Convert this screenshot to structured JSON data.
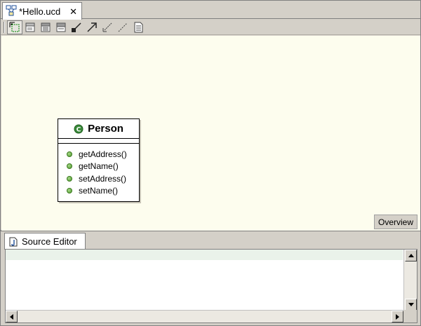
{
  "editor": {
    "tab_title": "*Hello.ucd",
    "tab_close": "✕"
  },
  "toolbar": {
    "buttons": [
      {
        "icon": "select-tool-icon",
        "active": true
      },
      {
        "icon": "class-tool-icon"
      },
      {
        "icon": "interface-tool-icon"
      },
      {
        "icon": "enum-tool-icon"
      },
      {
        "icon": "dependency-tool-icon"
      },
      {
        "icon": "association-tool-icon"
      },
      {
        "icon": "inheritance-tool-icon"
      },
      {
        "icon": "realization-tool-icon"
      },
      {
        "icon": "note-tool-icon"
      }
    ]
  },
  "diagram": {
    "class": {
      "stereotype_glyph": "C",
      "name": "Person",
      "methods": [
        "getAddress()",
        "getName()",
        "setAddress()",
        "setName()"
      ]
    },
    "overview_label": "Overview"
  },
  "source_editor": {
    "tab_label": "Source Editor"
  },
  "colors": {
    "canvas_bg": "#fdfdee",
    "window_bg": "#d4d0c8",
    "method_dot": "#4e9a2c",
    "class_glyph": "#3a8a3a"
  }
}
